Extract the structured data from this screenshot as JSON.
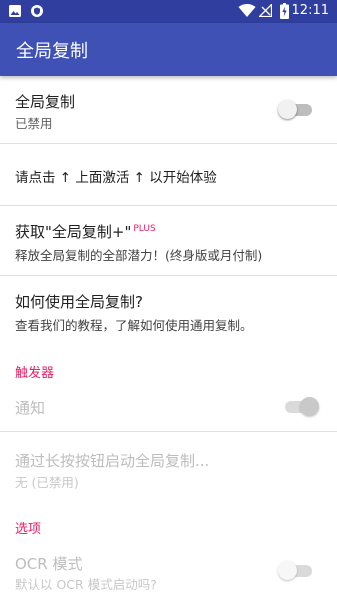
{
  "status_bar": {
    "time": "12:11",
    "icons": [
      "image-icon",
      "vpn-shield-icon",
      "wifi-icon",
      "signal-icon",
      "battery-charging-icon"
    ]
  },
  "app_bar": {
    "title": "全局复制"
  },
  "settings": {
    "global_copy": {
      "title": "全局复制",
      "subtitle": "已禁用",
      "toggle_on": false
    },
    "hint": {
      "text": "请点击 ↑ 上面激活 ↑ 以开始体验"
    },
    "plus": {
      "title": "获取\"全局复制+\"",
      "badge": "PLUS",
      "subtitle": "释放全局复制的全部潜力！(终身版或月付制)"
    },
    "how_to": {
      "title": "如何使用全局复制?",
      "subtitle": "查看我们的教程，了解如何使用通用复制。"
    },
    "trigger_category": "触发器",
    "notification": {
      "title": "通知",
      "toggle_on": true
    },
    "long_press": {
      "title": "通过长按按钮启动全局复制...",
      "subtitle": "无 (已禁用)"
    },
    "options_category": "选项",
    "ocr_mode": {
      "title": "OCR 模式",
      "subtitle": "默认以 OCR 模式启动吗?",
      "toggle_on": false
    }
  },
  "colors": {
    "primary": "#3f51b5",
    "primary_dark": "#303f9f",
    "accent": "#e91e63"
  }
}
